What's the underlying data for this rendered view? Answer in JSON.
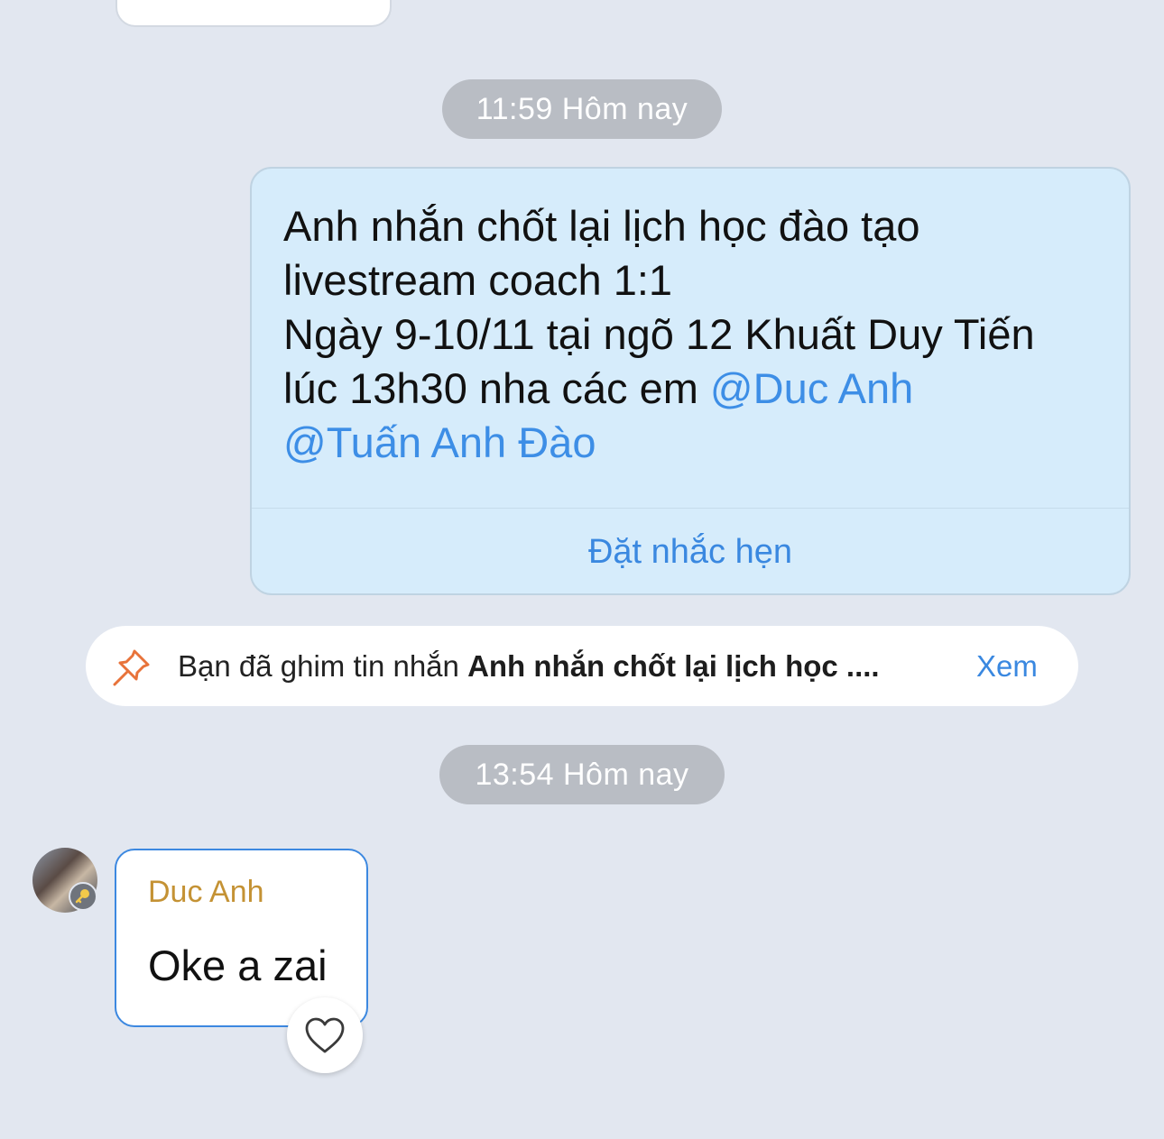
{
  "timestamps": {
    "first": "11:59 Hôm nay",
    "second": "13:54 Hôm nay"
  },
  "sent_message": {
    "lines": [
      "Anh nhắn chốt lại lịch học đào tạo",
      "livestream coach 1:1",
      "Ngày 9-10/11 tại ngõ 12 Khuất Duy Tiến",
      "lúc 13h30 nha các em "
    ],
    "mention_1": "@Duc Anh",
    "mention_2": "@Tuấn Anh Đào",
    "reminder_action": "Đặt nhắc hẹn"
  },
  "pin_notice": {
    "prefix": "Bạn đã ghim tin nhắn ",
    "message_excerpt": "Anh nhắn chốt lại lịch học ....",
    "view_label": "Xem",
    "icon": "pin-icon",
    "icon_color": "#e8733a"
  },
  "received_message": {
    "sender": "Duc Anh",
    "text": "Oke a zai",
    "sender_color": "#c49234"
  },
  "colors": {
    "background": "#e2e7f0",
    "sent_bubble": "#d6ecfb",
    "accent": "#3a88e0"
  }
}
